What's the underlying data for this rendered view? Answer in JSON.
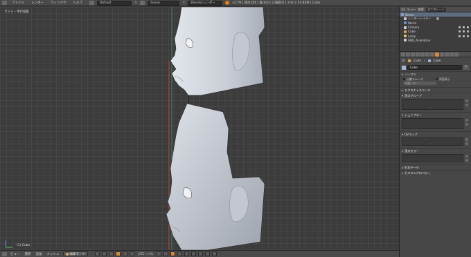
{
  "topbar": {
    "menus": [
      "ファイル",
      "レンダー",
      "ウィンドウ",
      "ヘルプ"
    ],
    "layout_field": "Default",
    "scene_field": "Scene",
    "engine": "Blenderレンダー",
    "info": "v2.79 | 頂点:0/6 | 面:0/3 | 三角面:0 | メモリ:54.82M | Cube"
  },
  "viewport": {
    "label": "ライト・平行投影",
    "object_label": "(1) Cube"
  },
  "bottombar": {
    "items": [
      "ビュー",
      "選択",
      "追加",
      "メッシュ"
    ],
    "mode": "編集モード",
    "pivot": "グローバル"
  },
  "outliner": {
    "menu_view": "ビュー",
    "menu_search": "検索",
    "dropdown": "全てのシーン",
    "rows": [
      {
        "label": "Scene",
        "icon_color": "#8aa0c8",
        "indent": 2,
        "highlight": true
      },
      {
        "label": "レンダーレイヤー",
        "icon_color": "#c8c8c8",
        "indent": 6,
        "highlight": false
      },
      {
        "label": "World",
        "icon_color": "#6a9bd0",
        "indent": 6,
        "highlight": false
      },
      {
        "label": "Camera",
        "icon_color": "#cccccc",
        "indent": 6,
        "highlight": false
      },
      {
        "label": "Cube",
        "icon_color": "#e0a45a",
        "indent": 6,
        "highlight": false
      },
      {
        "label": "Lamp",
        "icon_color": "#e8d060",
        "indent": 6,
        "highlight": false
      },
      {
        "label": "RBD_Animation",
        "icon_color": "#d0d0d0",
        "indent": 6,
        "highlight": false
      }
    ]
  },
  "properties": {
    "breadcrumb_object": "Cube",
    "breadcrumb_data": "Cube",
    "name_value": "Cube",
    "name_fake_user": "F",
    "sections": {
      "normals": "ノーマル",
      "auto_smooth": "自動スムーズ",
      "double_sided": "両面表示",
      "angle": "角度: 30°",
      "texture_space": "テクスチャスペース",
      "vertex_groups": "頂点グループ",
      "shape_keys": "シェイプキー",
      "uv_maps": "UVマップ",
      "vertex_colors": "頂点カラー",
      "geometry_data": "形状データ",
      "custom_props": "カスタムプロパティ"
    },
    "list_dots": "…"
  },
  "colors": {
    "accent": "#d98a32",
    "viewport_bg": "#3c3c3c",
    "panel_bg": "#474747",
    "selection": "#5f6d80"
  }
}
